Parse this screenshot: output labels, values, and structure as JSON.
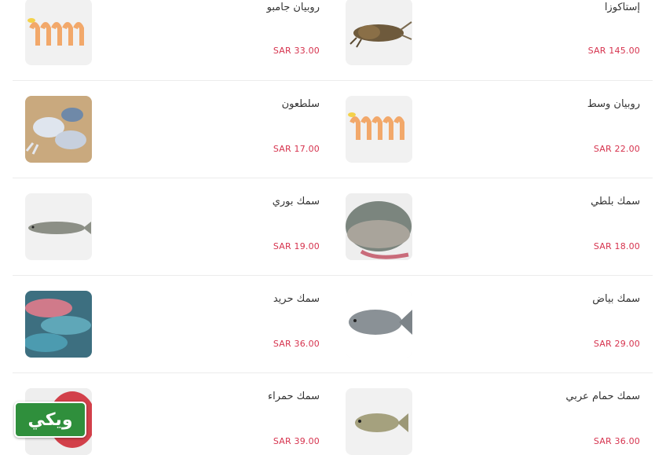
{
  "products": [
    {
      "name": "إستاكوزا",
      "price": "SAR 145.00",
      "icon": "lobster-image"
    },
    {
      "name": "روبيان جامبو",
      "price": "SAR 33.00",
      "icon": "shrimp-image"
    },
    {
      "name": "روبيان وسط",
      "price": "SAR 22.00",
      "icon": "shrimp-image"
    },
    {
      "name": "سلطعون",
      "price": "SAR 17.00",
      "icon": "crab-image"
    },
    {
      "name": "سمك بلطي",
      "price": "SAR 18.00",
      "icon": "tilapia-image"
    },
    {
      "name": "سمك بوري",
      "price": "SAR 19.00",
      "icon": "mullet-image"
    },
    {
      "name": "سمك بياض",
      "price": "SAR 29.00",
      "icon": "fish-image"
    },
    {
      "name": "سمك حريد",
      "price": "SAR 36.00",
      "icon": "parrotfish-image"
    },
    {
      "name": "سمك حمام عربي",
      "price": "SAR 36.00",
      "icon": "fish-image"
    },
    {
      "name": "سمك حمراء",
      "price": "SAR 39.00",
      "icon": "red-snapper-image"
    }
  ],
  "badge": {
    "label": "ويكي"
  },
  "colors": {
    "price": "#d6334e",
    "badge": "#2f8f3c"
  }
}
